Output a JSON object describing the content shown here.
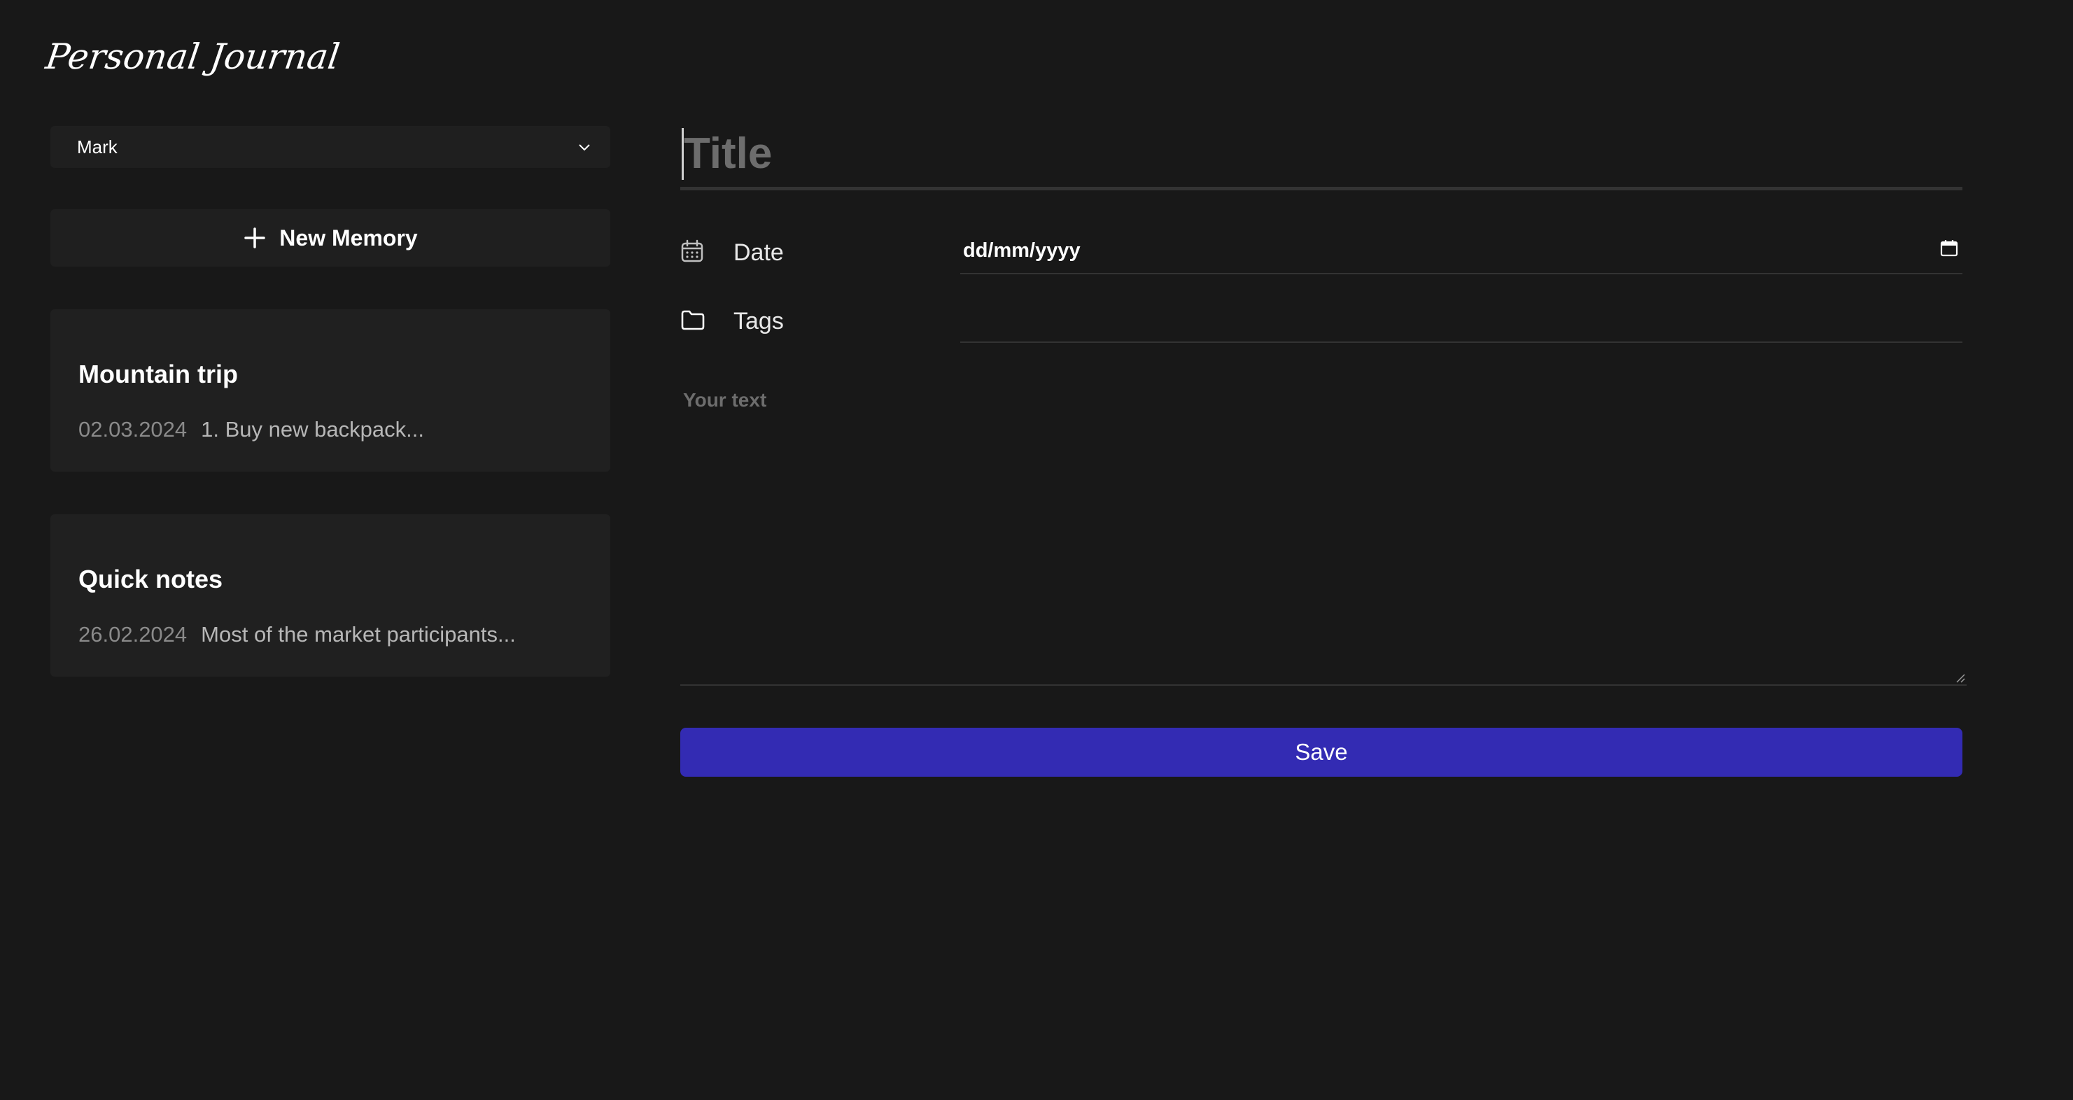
{
  "app": {
    "title": "Personal Journal"
  },
  "sidebar": {
    "user_select": {
      "selected": "Mark",
      "icon": "chevron-down-icon"
    },
    "new_memory": {
      "label": "New Memory",
      "icon": "plus-icon"
    },
    "memories": [
      {
        "title": "Mountain trip",
        "date": "02.03.2024",
        "preview": "1. Buy new backpack..."
      },
      {
        "title": "Quick notes",
        "date": "26.02.2024",
        "preview": "Most of the market participants..."
      }
    ]
  },
  "editor": {
    "title_placeholder": "Title",
    "date": {
      "label": "Date",
      "value": "dd/mm/yyyy",
      "icon": "calendar-icon",
      "picker_icon": "calendar-picker-icon"
    },
    "tags": {
      "label": "Tags",
      "value": "",
      "icon": "folder-icon"
    },
    "text_placeholder": "Your text",
    "save_label": "Save"
  },
  "colors": {
    "background": "#181818",
    "panel": "#1f1f1f",
    "card": "#202020",
    "accent": "#332bb3",
    "muted_text": "#8a8a8a",
    "placeholder": "#6d6d6d",
    "divider": "#333333"
  }
}
